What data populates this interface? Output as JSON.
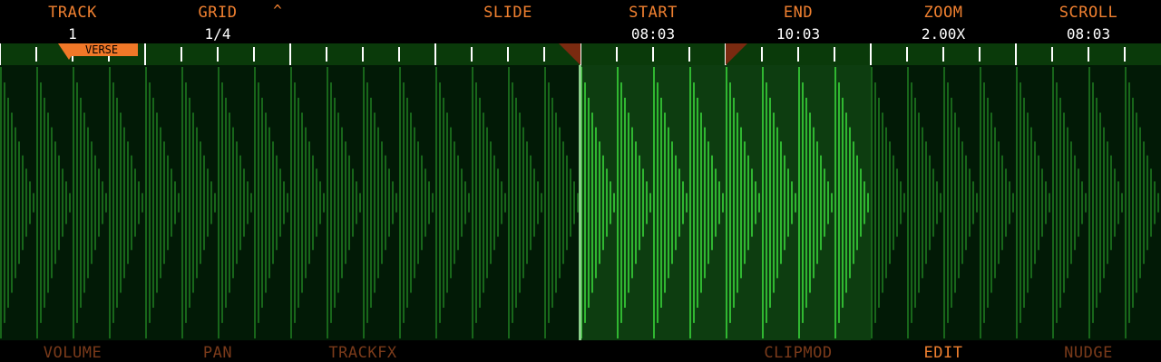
{
  "colors": {
    "label": "#f08030",
    "value": "#ffffff",
    "footer_dim": "#7a3a1a",
    "footer_active": "#f08030",
    "wave_dim": "#1f7a1f",
    "wave_bright": "#3ad63a",
    "region_bg": "#0d3d10",
    "playhead": "#8ad08a",
    "loop_marker": "#7a2a10"
  },
  "header": {
    "params": [
      {
        "label": "TRACK",
        "value": "1"
      },
      {
        "label": "GRID",
        "value": "1/4"
      },
      {
        "label": "",
        "value": ""
      },
      {
        "label": "SLIDE",
        "value": ""
      },
      {
        "label": "START",
        "value": "08:03"
      },
      {
        "label": "END",
        "value": "10:03"
      },
      {
        "label": "ZOOM",
        "value": "2.00X"
      },
      {
        "label": "SCROLL",
        "value": "08:03"
      }
    ],
    "caret": "^"
  },
  "marker": {
    "label": "VERSE"
  },
  "footer": {
    "items": [
      {
        "label": "VOLUME",
        "active": false
      },
      {
        "label": "PAN",
        "active": false
      },
      {
        "label": "TRACKFX",
        "active": false
      },
      {
        "label": "",
        "active": false
      },
      {
        "label": "",
        "active": false
      },
      {
        "label": "CLIPMOD",
        "active": false
      },
      {
        "label": "EDIT",
        "active": true
      },
      {
        "label": "NUDGE",
        "active": false
      }
    ]
  }
}
